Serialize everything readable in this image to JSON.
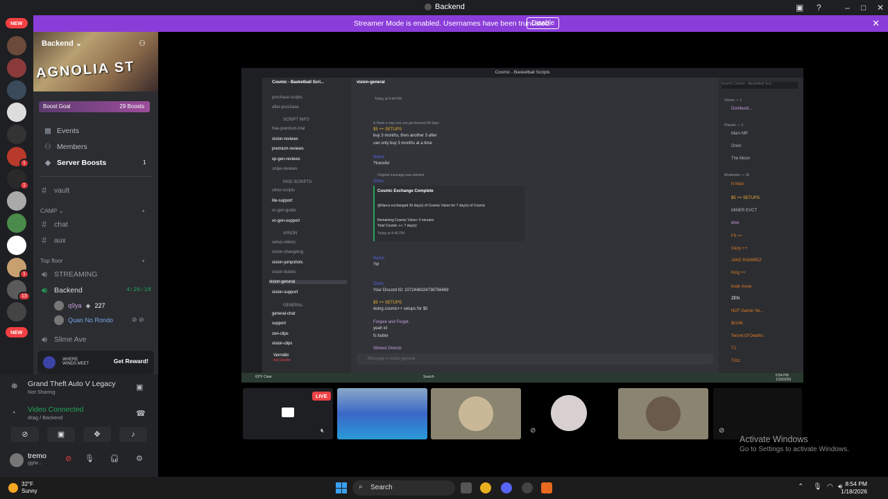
{
  "window": {
    "title": "Backend"
  },
  "banner": {
    "message": "Streamer Mode is enabled. Usernames have been truncated.",
    "disable_label": "Disable",
    "color": "#8b3dd9"
  },
  "rail": {
    "new_label": "NEW",
    "badges": [
      "1",
      "1",
      "1",
      "13"
    ]
  },
  "server": {
    "name": "Backend",
    "banner_text": "AGNOLIA ST",
    "boost_goal_label": "Boost Goal",
    "boost_count": "29 Boosts",
    "nav": [
      {
        "label": "Events",
        "icon": "calendar-icon"
      },
      {
        "label": "Members",
        "icon": "members-icon"
      },
      {
        "label": "Server Boosts",
        "icon": "boost-icon",
        "count": "1"
      }
    ],
    "channels": {
      "vault": "vault",
      "camp_category": "CAMP",
      "chat": "chat",
      "aux": "aux",
      "top_floor_category": "Top floor",
      "streaming": "STREAMING",
      "backend_voice": "Backend",
      "backend_timer": "4:26:18",
      "voice_users": [
        {
          "name": "q9ya",
          "extra": "227"
        },
        {
          "name": "Quan No Rondo"
        }
      ],
      "slime_ave": "Slime Ave"
    },
    "promo": {
      "game_text": "WHERE WINDS MEET",
      "button": "Get Reward!"
    }
  },
  "user_panel": {
    "activity": "Grand Theft Auto V Legacy",
    "activity_status": "Not Sharing",
    "voice_status": "Video Connected",
    "voice_channel": "drag / Backend",
    "username": "tremo",
    "user_status": "gg/w..."
  },
  "stream_view": {
    "inner_title": "Cosmic - Basketball Scripts",
    "inner_server": "Cosmic - Basketball Scri...",
    "inner_channel": "vision-general",
    "inner_search": "Search Cosmic - Basketball Scri...",
    "inner_channels": [
      "purchase-scripts",
      "after-purchase",
      "SCRIPT INFO",
      "free-premium-trial",
      "vision-reviews",
      "premium-reviews",
      "xp-gen-reviews",
      "snipe-reviews",
      "PAID SCRIPTS",
      "other-scripts",
      "lite-support",
      "vc-gen-guide",
      "vc-gen-support",
      "VISION",
      "setup-videos",
      "vision-changelog",
      "vision-jumpshots",
      "vision-tickets",
      "vision-general",
      "vision-support",
      "GENERAL",
      "general-chat",
      "support",
      "zen-clips",
      "vision-clips"
    ],
    "messages": [
      {
        "author": "",
        "text": "Today at 4:44 PM"
      },
      {
        "author": "",
        "text": "is there a way you can get beyond 90 days"
      },
      {
        "author": "$5 ++ SETUPS",
        "text": "buy 3 months, then another 3 after"
      },
      {
        "author": "",
        "text": "can only buy 3 months at a time"
      },
      {
        "author": "Narco",
        "text": "?transfer"
      },
      {
        "author": "",
        "text": "Original message was deleted"
      },
      {
        "author": "Orion",
        "text": "Cosmic Exchange Complete"
      },
      {
        "author": "",
        "text": "@Narco exchanged 30 day(s) of Cosmic Vision for 7 day(s) of Cosmic"
      },
      {
        "author": "",
        "text": "Remaining Cosmic Vision: 0 minutes"
      },
      {
        "author": "",
        "text": "Total Cosmic ++: 7 day(s)"
      },
      {
        "author": "",
        "text": "Today at 4:46 PM"
      },
      {
        "author": "Narco",
        "text": "?id"
      },
      {
        "author": "Orion",
        "text": "Your Discord ID: 1072448324738756469"
      },
      {
        "author": "$5 ++ SETUPS",
        "text": "doing cosmic++ setups for $5"
      },
      {
        "author": "Forgive and Forget.",
        "text": "yeah icl"
      },
      {
        "author": "",
        "text": "fs butter"
      },
      {
        "author": "Slimest Drench",
        "text": ""
      }
    ],
    "inner_input_placeholder": "Message # vision-general",
    "inner_user": "Vermdkt",
    "inner_user_status": "Not Deafen",
    "members": [
      {
        "group": "Owner — 1"
      },
      {
        "name": "Dombusti..."
      },
      {
        "group": "Planets — 3"
      },
      {
        "name": "Mars MP"
      },
      {
        "name": "Orion"
      },
      {
        "name": "The Moon"
      },
      {
        "group": "Moderator — 16"
      },
      {
        "name": "N Mod"
      },
      {
        "name": "$5 ++ SETUPS"
      },
      {
        "name": "MINER EVCT"
      },
      {
        "name": "drex"
      },
      {
        "name": "F9 ++"
      },
      {
        "name": "Glory ++"
      },
      {
        "name": "JAKE RAMIREZ"
      },
      {
        "name": "King ++"
      },
      {
        "name": "hook move"
      },
      {
        "name": "ZEN"
      },
      {
        "name": "NOT Gamer Se..."
      },
      {
        "name": "$0148"
      },
      {
        "name": "Secret Of Deaths"
      },
      {
        "name": "TJ"
      },
      {
        "name": "Trizz"
      }
    ],
    "inner_weather": "63°F Clear",
    "inner_search_task": "Search",
    "inner_clock": "6:54 PM",
    "inner_date": "1/18/2026",
    "live_label": "LIVE",
    "activate_title": "Activate Windows",
    "activate_sub": "Go to Settings to activate Windows."
  },
  "taskbar": {
    "temp": "32°F",
    "condition": "Sunny",
    "search_label": "Search",
    "time": "8:54 PM",
    "date": "1/18/2026"
  }
}
